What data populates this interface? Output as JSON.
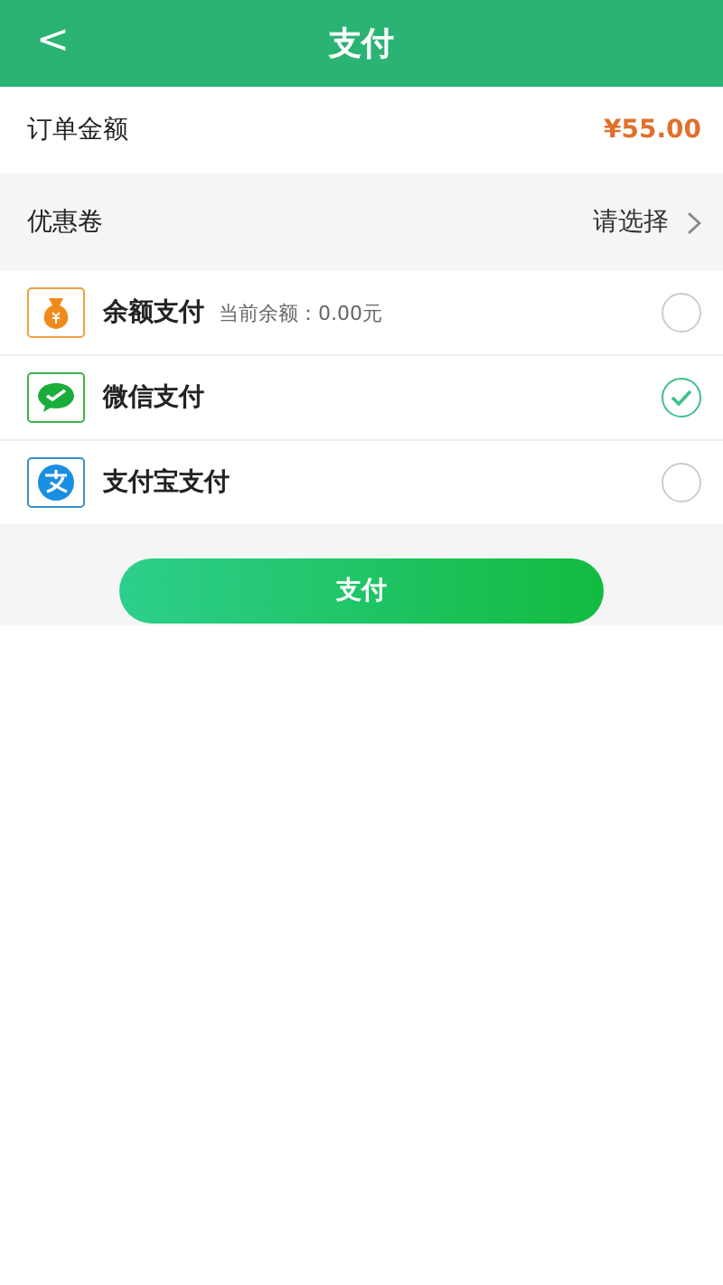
{
  "header": {
    "back": "<",
    "title": "支付"
  },
  "order": {
    "label": "订单金额",
    "amount": "¥55.00"
  },
  "coupon": {
    "label": "优惠卷",
    "value": "请选择"
  },
  "methods": [
    {
      "kind": "balance",
      "name": "余额支付",
      "note": "当前余额：0.00元",
      "selected": false
    },
    {
      "kind": "wechat",
      "name": "微信支付",
      "selected": true
    },
    {
      "kind": "alipay",
      "name": "支付宝支付",
      "selected": false
    }
  ],
  "pay_button": "支付"
}
